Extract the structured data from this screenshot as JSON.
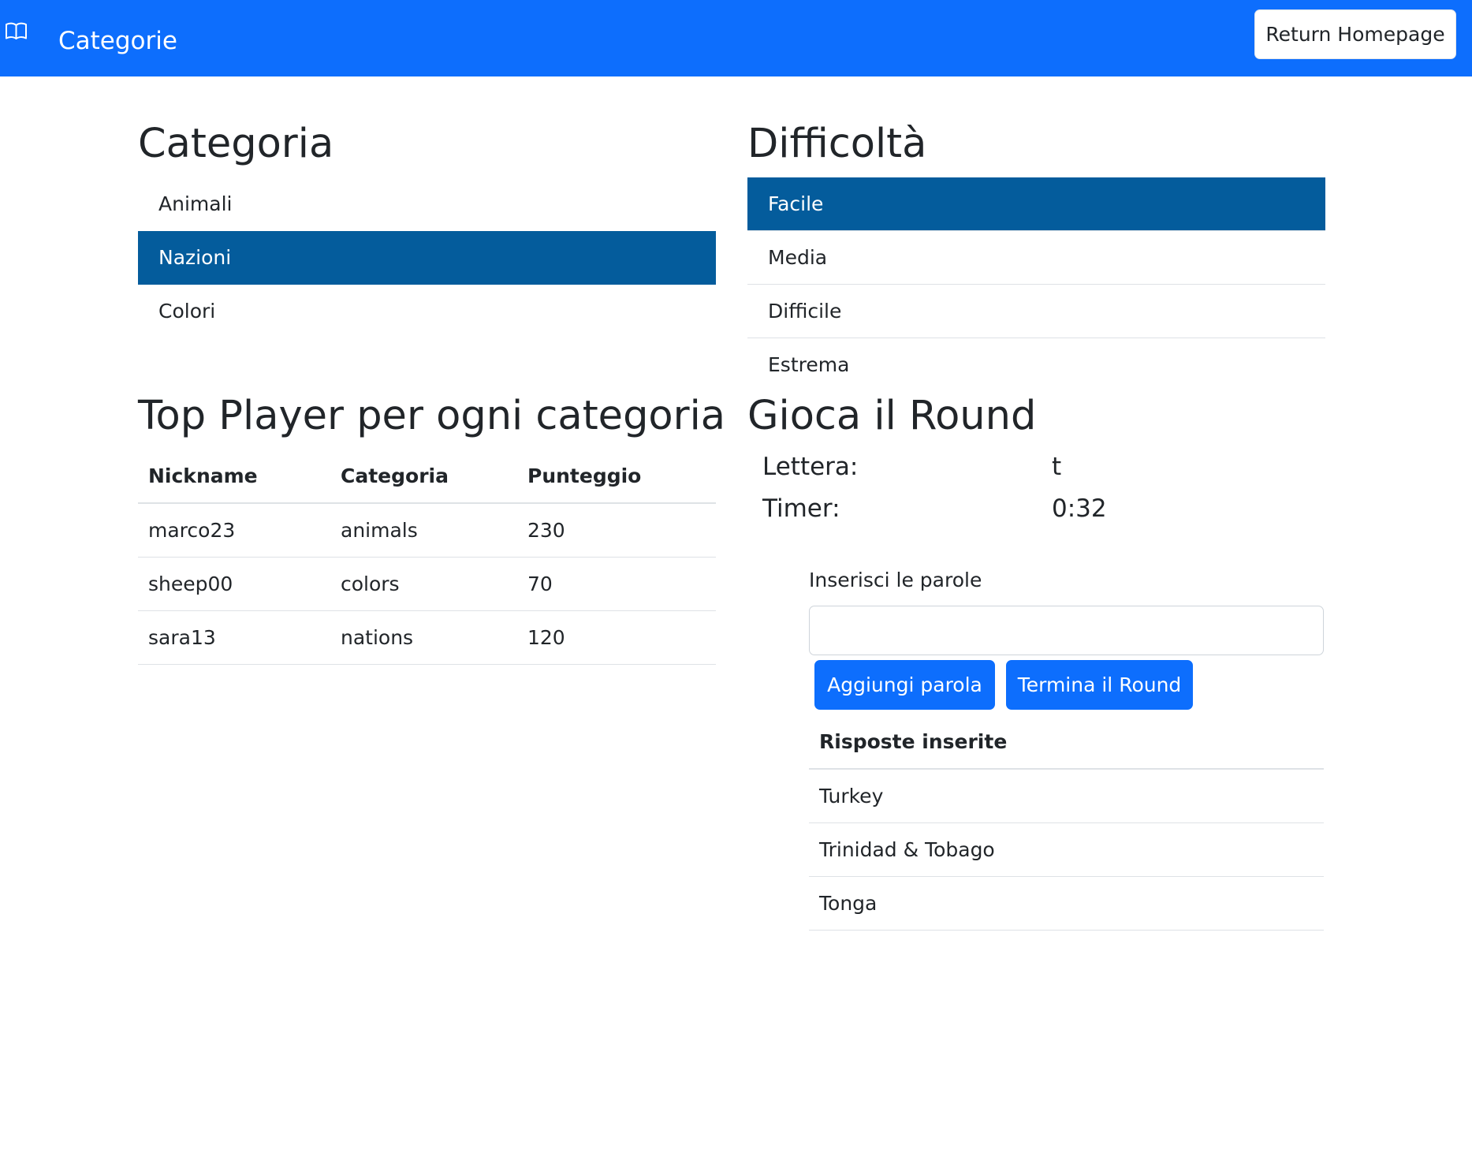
{
  "navbar": {
    "icon": "book-icon",
    "brand": "Categorie",
    "home_button": "Return Homepage",
    "color": "#0d6efd"
  },
  "categories": {
    "title": "Categoria",
    "items": [
      {
        "label": "Animali",
        "active": false
      },
      {
        "label": "Nazioni",
        "active": true
      },
      {
        "label": "Colori",
        "active": false
      }
    ],
    "active_color": "#045c9c"
  },
  "difficulty": {
    "title": "Difficoltà",
    "items": [
      {
        "label": "Facile",
        "active": true
      },
      {
        "label": "Media",
        "active": false
      },
      {
        "label": "Difficile",
        "active": false
      },
      {
        "label": "Estrema",
        "active": false
      }
    ]
  },
  "top_players": {
    "title": "Top Player per ogni categoria",
    "headers": [
      "Nickname",
      "Categoria",
      "Punteggio"
    ],
    "rows": [
      [
        "marco23",
        "animals",
        "230"
      ],
      [
        "sheep00",
        "colors",
        "70"
      ],
      [
        "sara13",
        "nations",
        "120"
      ]
    ]
  },
  "round": {
    "title": "Gioca il Round",
    "letter_label": "Lettera:",
    "letter_value": "t",
    "timer_label": "Timer:",
    "timer_value": "0:32",
    "input_label": "Inserisci le parole",
    "input_value": "",
    "add_button": "Aggiungi parola",
    "end_button": "Termina il Round",
    "answers_header": "Risposte inserite",
    "answers": [
      "Turkey",
      "Trinidad & Tobago",
      "Tonga"
    ]
  }
}
